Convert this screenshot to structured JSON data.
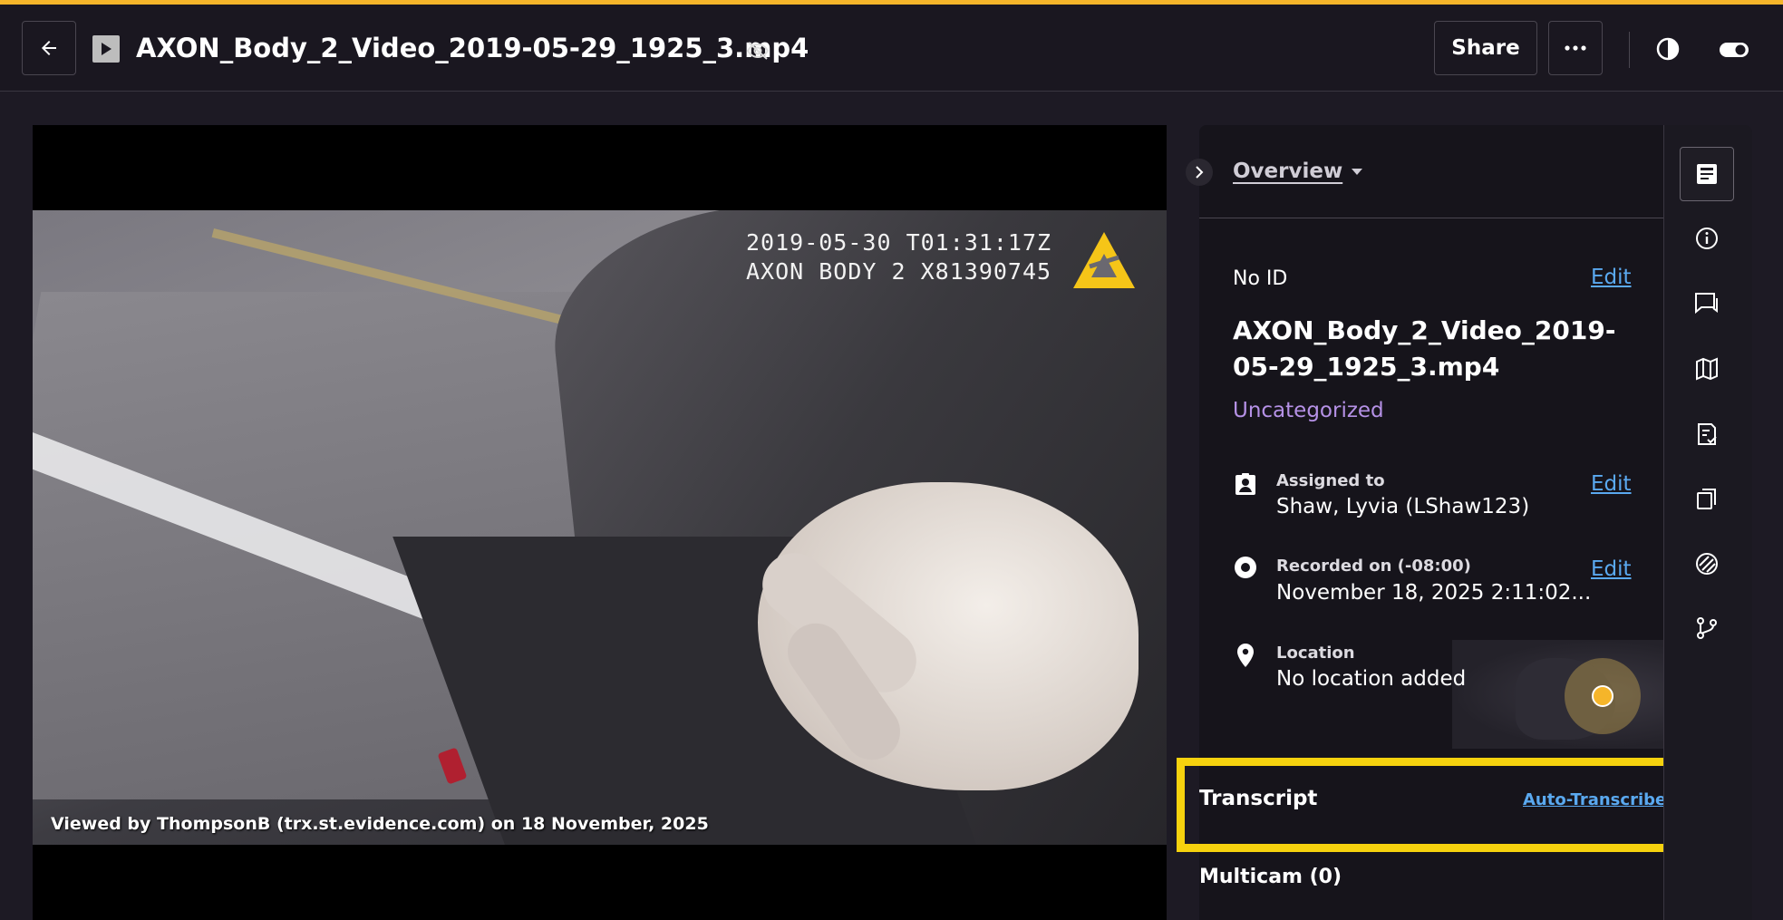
{
  "header": {
    "title": "AXON_Body_2_Video_2019-05-29_1925_3.mp4",
    "share_label": "Share",
    "more_label": "···"
  },
  "video": {
    "hud_line1": "2019-05-30 T01:31:17Z",
    "hud_line2": "AXON BODY 2 X81390745",
    "watermark": "Viewed by ThompsonB (trx.st.evidence.com) on 18 November, 2025"
  },
  "panel": {
    "tab_label": "Overview",
    "id_label": "No ID",
    "edit_label": "Edit",
    "name": "AXON_Body_2_Video_2019-05-29_1925_3.mp4",
    "category": "Uncategorized",
    "assigned_label": "Assigned to",
    "assigned_value": "Shaw, Lyvia (LShaw123)",
    "recorded_label": "Recorded on (-08:00)",
    "recorded_value": "November 18, 2025 2:11:02...",
    "location_label": "Location",
    "location_value": "No location added",
    "transcript_label": "Transcript",
    "auto_transcribe_label": "Auto-Transcribe",
    "multicam_label": "Multicam (0)"
  },
  "colors": {
    "accent": "#f5b52a",
    "link": "#5aa9f0",
    "category": "#b591e6",
    "highlight": "#f6d20e"
  },
  "rail_icons": [
    "overview-icon",
    "info-icon",
    "comments-icon",
    "map-icon",
    "audit-icon",
    "copies-icon",
    "redaction-icon",
    "branch-icon"
  ]
}
